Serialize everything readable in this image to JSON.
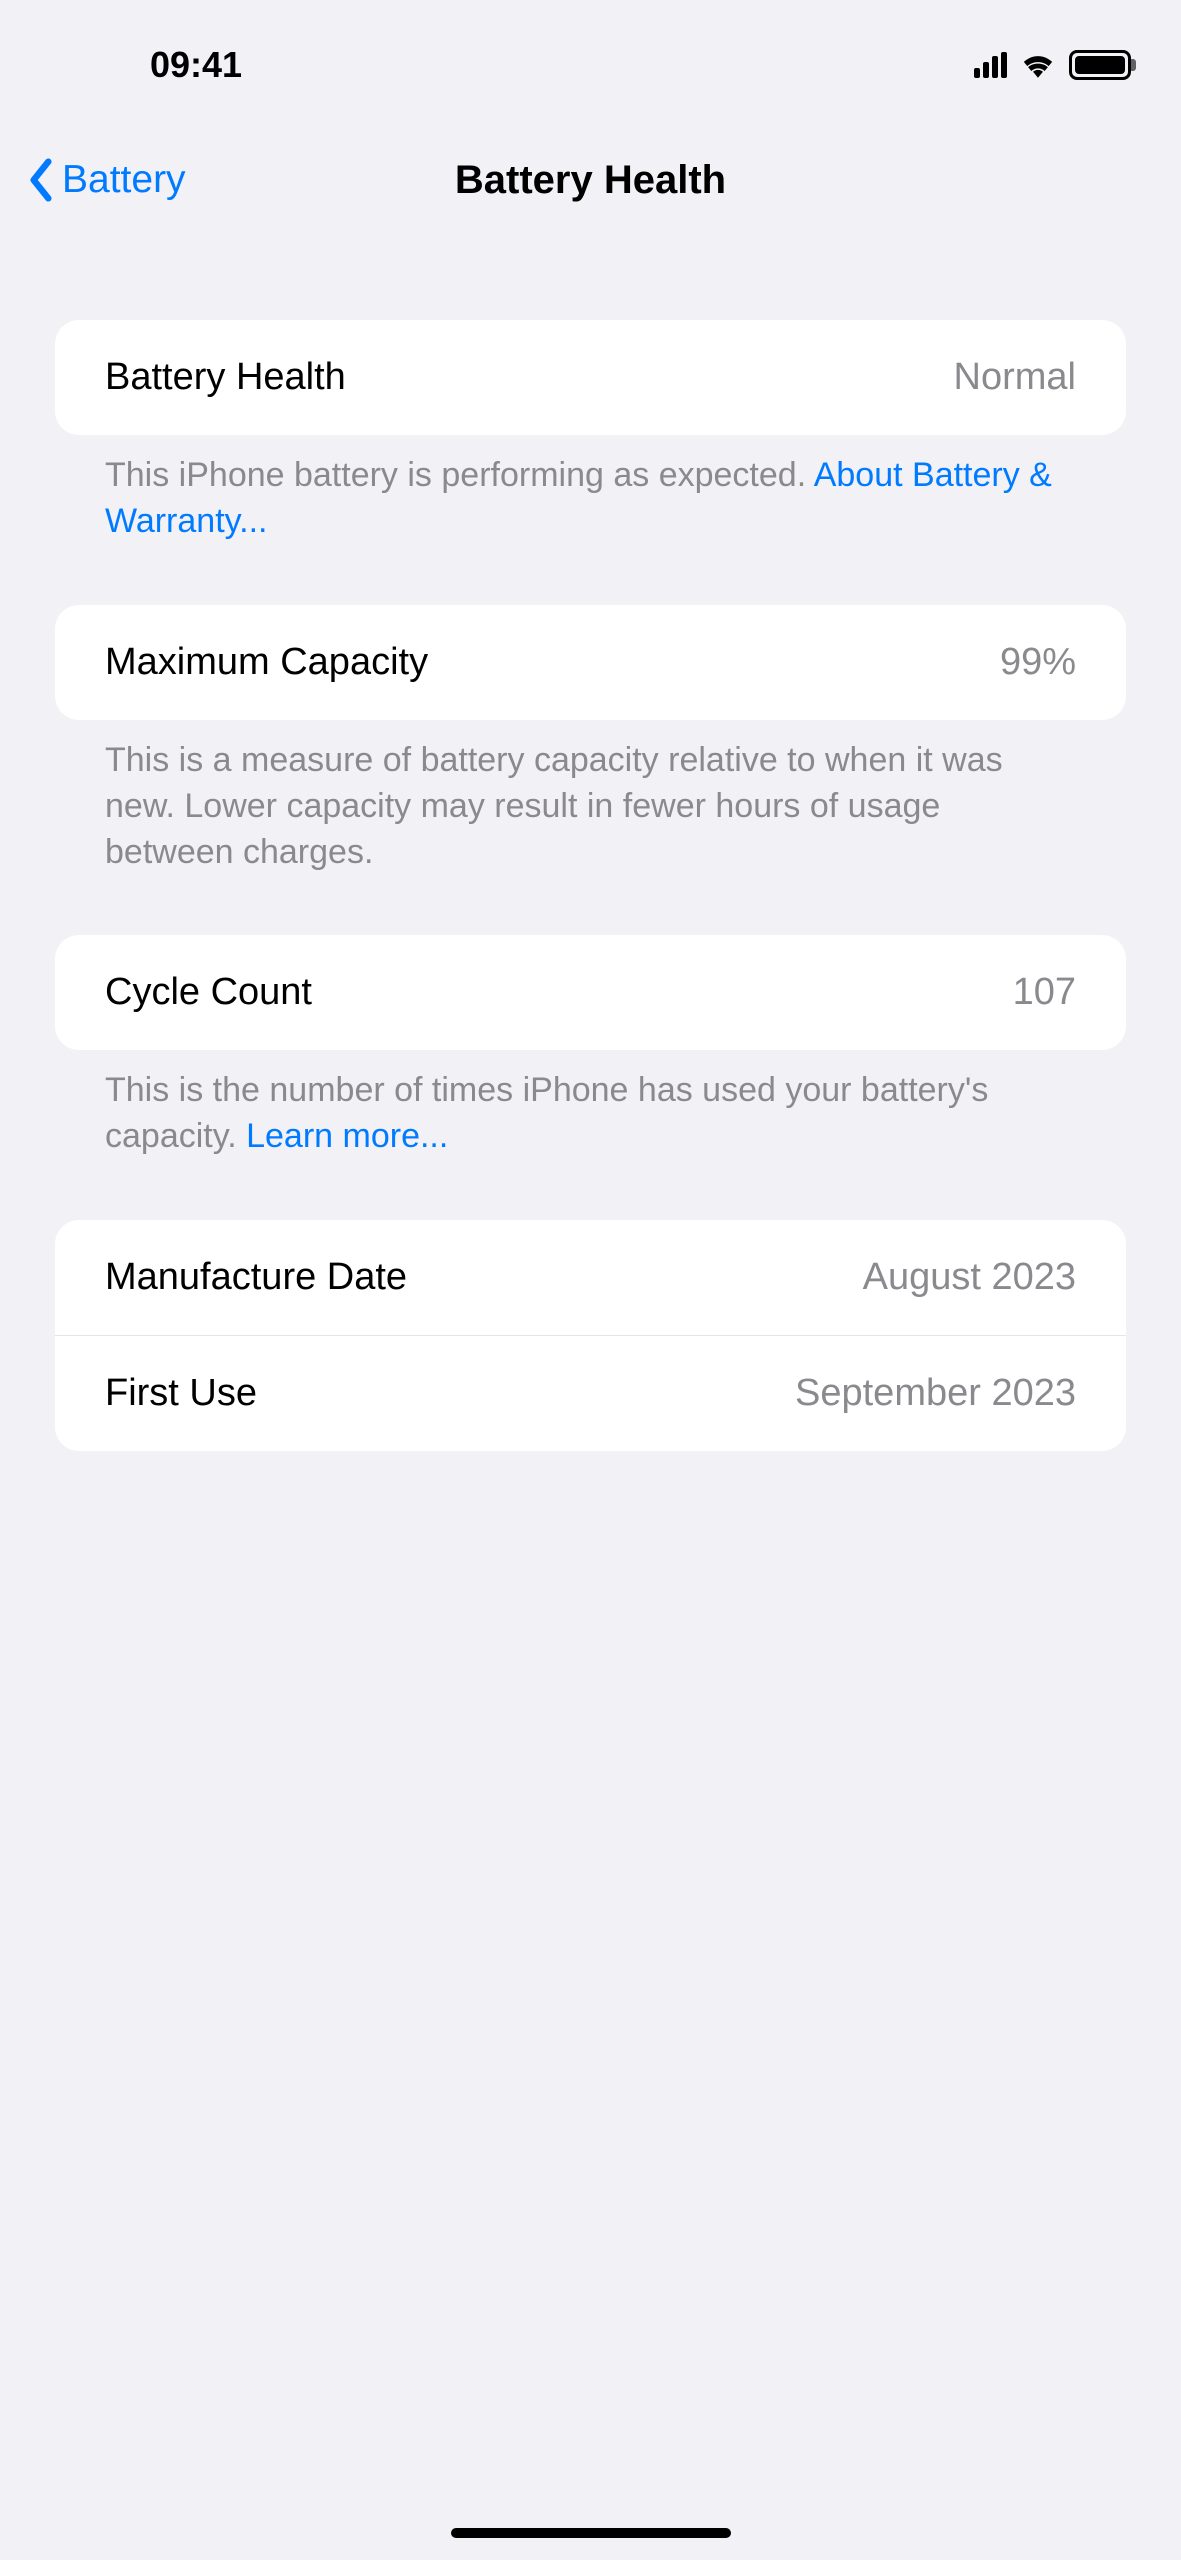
{
  "status": {
    "time": "09:41"
  },
  "nav": {
    "back_label": "Battery",
    "title": "Battery Health"
  },
  "sections": {
    "health": {
      "label": "Battery Health",
      "value": "Normal",
      "footer_text": "This iPhone battery is performing as expected. ",
      "footer_link": "About Battery & Warranty..."
    },
    "capacity": {
      "label": "Maximum Capacity",
      "value": "99%",
      "footer_text": "This is a measure of battery capacity relative to when it was new. Lower capacity may result in fewer hours of usage between charges."
    },
    "cycle": {
      "label": "Cycle Count",
      "value": "107",
      "footer_text": "This is the number of times iPhone has used your battery's capacity. ",
      "footer_link": "Learn more..."
    },
    "dates": {
      "manufacture_label": "Manufacture Date",
      "manufacture_value": "August 2023",
      "first_use_label": "First Use",
      "first_use_value": "September 2023"
    }
  }
}
